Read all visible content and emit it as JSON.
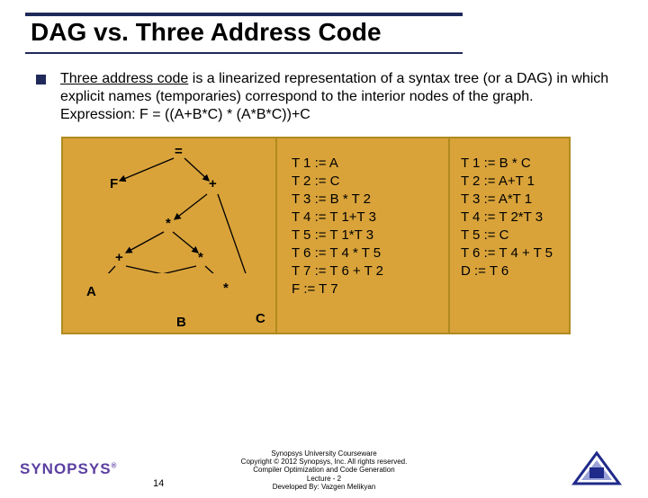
{
  "title": "DAG vs. Three Address Code",
  "paragraph": {
    "underline_lead": "Three address code",
    "rest": " is a linearized representation of a syntax tree (or a DAG) in which explicit names (temporaries) correspond to the interior nodes of the graph.",
    "expression_line": "Expression: F = ((A+B*C) * (A*B*C))+C"
  },
  "dag_nodes": {
    "eq": "=",
    "F": "F",
    "plus1": "+",
    "star1": "*",
    "plus2": "+",
    "star2": "*",
    "A": "A",
    "star3": "*",
    "B": "B",
    "C": "C"
  },
  "tac": [
    "T 1 := A",
    "T 2 := C",
    "T 3 := B * T 2",
    "T 4 := T 1+T 3",
    "T 5 := T 1*T 3",
    "T 6 := T 4 * T 5",
    "T 7 := T 6 + T 2",
    "F := T 7"
  ],
  "opt": [
    "T 1 := B * C",
    "T 2 := A+T 1",
    "T 3 := A*T 1",
    "T 4 := T 2*T 3",
    "T 5 := C",
    "T 6 := T 4 + T 5",
    "D := T 6"
  ],
  "footer": {
    "l1": "Synopsys University Courseware",
    "l2": "Copyright © 2012 Synopsys, Inc. All rights reserved.",
    "l3": "Compiler Optimization and Code Generation",
    "l4": "Lecture - 2",
    "l5": "Developed By: Vazgen Melikyan"
  },
  "page": "14",
  "logo_text": "SYNOPSYS"
}
